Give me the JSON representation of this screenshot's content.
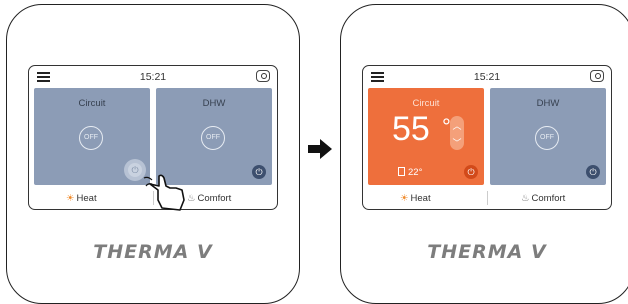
{
  "brand": "THERMA V",
  "panels": [
    {
      "clock": "15:21",
      "tiles": [
        {
          "title": "Circuit",
          "state": "OFF"
        },
        {
          "title": "DHW",
          "state": "OFF"
        }
      ],
      "modes": {
        "heat": "Heat",
        "comfort": "Comfort"
      }
    },
    {
      "clock": "15:21",
      "tiles": [
        {
          "title": "Circuit",
          "temperature": "55",
          "unit": "°",
          "room_temp": "22°"
        },
        {
          "title": "DHW",
          "state": "OFF"
        }
      ],
      "modes": {
        "heat": "Heat",
        "comfort": "Comfort"
      }
    }
  ],
  "colors": {
    "tile_off": "#8c9cb6",
    "tile_active": "#ee6f3c",
    "heat_icon": "#f08c2e"
  }
}
